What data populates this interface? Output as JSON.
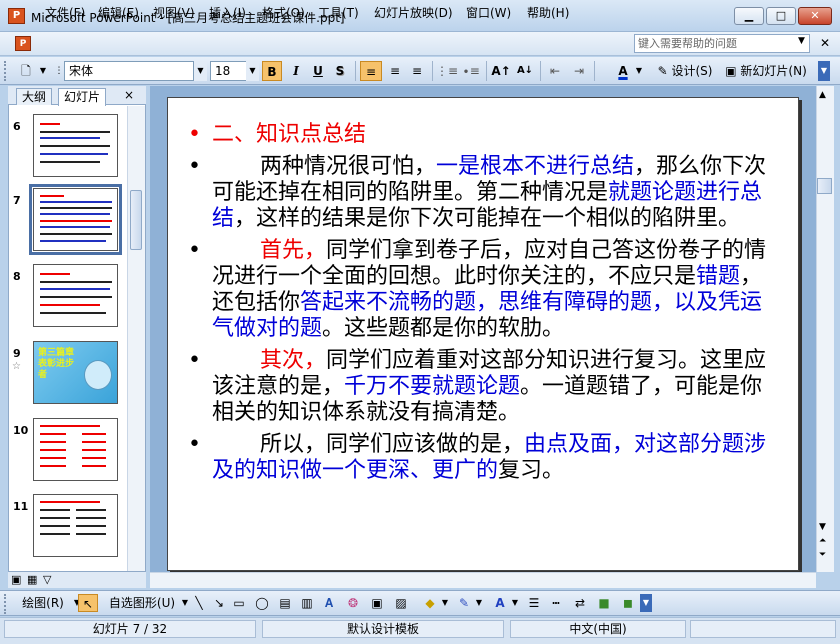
{
  "window": {
    "title": "Microsoft PowerPoint - [高三月考总结主题班会课件.ppt]",
    "app_icon_text": "P"
  },
  "menu": [
    "文件(F)",
    "编辑(E)",
    "视图(V)",
    "插入(I)",
    "格式(O)",
    "工具(T)",
    "幻灯片放映(D)",
    "窗口(W)",
    "帮助(H)"
  ],
  "help_placeholder": "键入需要帮助的问题",
  "toolbar": {
    "font": "宋体",
    "size": "18",
    "bold": "B",
    "italic": "I",
    "underline": "U",
    "shadow": "S",
    "design": "设计(S)",
    "new_slide": "新幻灯片(N)"
  },
  "panel": {
    "tabs": [
      "大纲",
      "幻灯片"
    ],
    "close": "×"
  },
  "thumbnails": [
    {
      "num": "6"
    },
    {
      "num": "7"
    },
    {
      "num": "8"
    },
    {
      "num": "9",
      "text": "第三篇章 表彰进步者"
    },
    {
      "num": "10"
    },
    {
      "num": "11"
    }
  ],
  "slide": {
    "heading": "二、知识点总结",
    "p1": {
      "a": "两种情况很可怕，",
      "b": "一是根本不进行总结",
      "c": "，那么你下次可能还掉在相同的陷阱里。第二种情况是",
      "d": "就题论题进行总结",
      "e": "，这样的结果是你下次可能掉在一个相似的陷阱里。"
    },
    "p2": {
      "a": "首先，",
      "b": "同学们拿到卷子后，应对自己答这份卷子的情况进行一个全面的回想。此时你关注的，不应只是",
      "c": "错题",
      "d": "，还包括你",
      "e": "答起来不流畅的题，思维有障碍的题，以及凭运气做对的题",
      "f": "。这些题都是你的软肋。"
    },
    "p3": {
      "a": "其次，",
      "b": "同学们应着重对这部分知识进行复习。这里应该注意的是，",
      "c": "千万不要就题论题",
      "d": "。一道题错了，可能是你相关的知识体系就没有搞清楚。"
    },
    "p4": {
      "a": "所以，同学们应该做的是，",
      "b": "由点及面，对这部分题涉及的知识做一个更深、更广的",
      "c": "复习。"
    }
  },
  "drawbar": {
    "draw": "绘图(R)",
    "autoshape": "自选图形(U)"
  },
  "status": {
    "slide": "幻灯片 7 / 32",
    "template": "默认设计模板",
    "lang": "中文(中国)"
  }
}
